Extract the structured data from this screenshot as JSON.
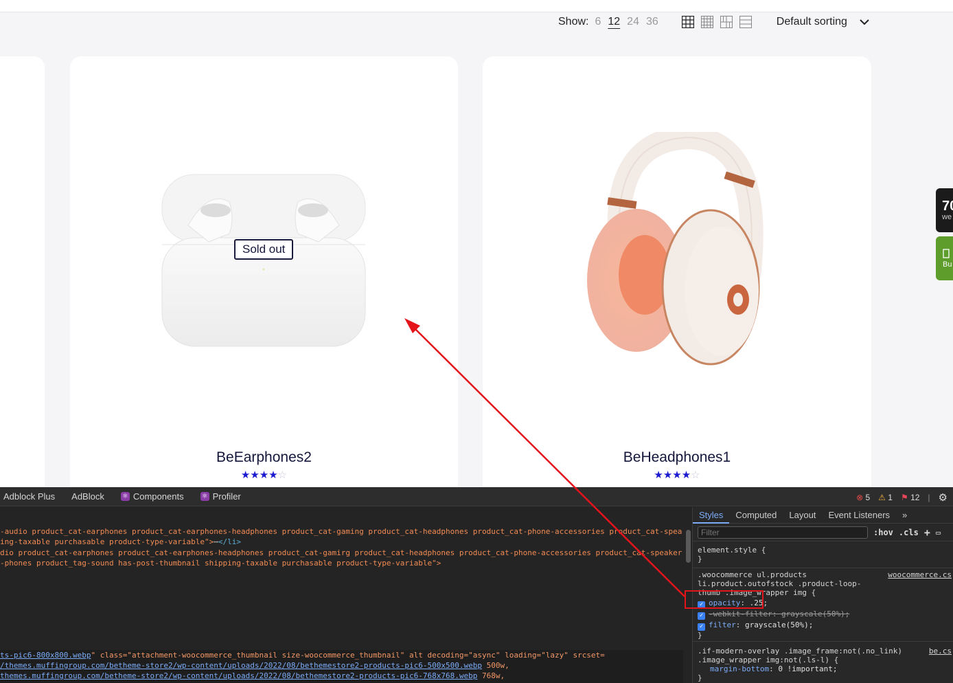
{
  "toolbar": {
    "show_label": "Show:",
    "counts": [
      "6",
      "12",
      "24",
      "36"
    ],
    "active_count": "12",
    "layout_icons": [
      "grid-4-icon",
      "grid-5-icon",
      "grid-masonry-icon",
      "list-icon"
    ],
    "sort_label": "Default sorting"
  },
  "products": [
    {
      "title": "BeEarphones2",
      "badge": "Sold out",
      "rating": 4,
      "max_rating": 5
    },
    {
      "title": "BeHeadphones1",
      "rating": 4,
      "max_rating": 5
    }
  ],
  "side_widgets": {
    "dark_big": "70",
    "dark_small": "we",
    "green_small": "Bu"
  },
  "devtools": {
    "tabs": [
      "Adblock Plus",
      "AdBlock",
      "Components",
      "Profiler"
    ],
    "errors": "5",
    "warnings": "1",
    "issues": "12",
    "elements": {
      "line1": "-audio product_cat-earphones product_cat-earphones-headphones product_cat-gaming product_cat-headphones product_cat-phone-accessories product_cat-spea",
      "line2a": "ing-taxable purchasable product-type-variable\">",
      "line2b": "</li>",
      "line3": "dio product_cat-earphones product_cat-earphones-headphones product_cat-gamirg product_cat-headphones product_cat-phone-accessories product_cat-speaker",
      "line4": "-phones product_tag-sound has-post-thumbnail shipping-taxable purchasable product-type-variable\">",
      "sel_line1_link": "ts-pic6-800x800.webp",
      "sel_line1_rest": "\" class=\"attachment-woocommerce_thumbnail size-woocommerce_thumbnail\" alt decoding=\"async\" loading=\"lazy\" srcset=",
      "sel_line2_link": "/themes.muffingroup.com/betheme-store2/wp-content/uploads/2022/08/bethemestore2-products-pic6-500x500.webp",
      "sel_line2_rest": " 500w,",
      "sel_line3_link": "themes.muffingroup.com/betheme-store2/wp-content/uploads/2022/08/bethemestore2-products-pic6-768x768.webp",
      "sel_line3_rest": " 768w,"
    },
    "styles": {
      "tabs": [
        "Styles",
        "Computed",
        "Layout",
        "Event Listeners"
      ],
      "filter_placeholder": "Filter",
      "hov": ":hov",
      "cls": ".cls",
      "element_style": "element.style {",
      "rule1_selector_1": ".woocommerce ul.products",
      "rule1_selector_2": "li.product.outofstock .product-loop-",
      "rule1_selector_3": "thumb .image_wrapper img {",
      "rule1_source": "woocommerce.cs",
      "decl1_prop": "opacity",
      "decl1_val": ".25;",
      "decl2_prop": "-webkit-filter",
      "decl2_val": "grayscale(50%);",
      "decl3_prop": "filter",
      "decl3_val": "grayscale(50%);",
      "rule2_selector_1": ".if-modern-overlay .image_frame:not(.no_link)",
      "rule2_selector_2": ".image_wrapper img:not(.ls-l) {",
      "rule2_source": "be.cs",
      "decl4_prop": "margin-bottom",
      "decl4_val": "0 !important;",
      "close_brace": "}"
    }
  },
  "colors": {
    "accent_blue": "#1a1ad0",
    "annotation_red": "#e4141b",
    "devtools_link": "#7cacf8"
  }
}
